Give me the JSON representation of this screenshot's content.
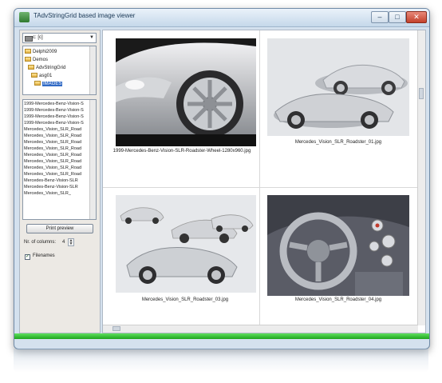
{
  "window": {
    "title": "TAdvStringGrid based image viewer",
    "minimize_glyph": "–",
    "maximize_glyph": "□",
    "close_glyph": "✕"
  },
  "sidebar": {
    "drive_label": "c: [c]",
    "drive_arrow": "▼",
    "tree": [
      {
        "label": "Delphi2009",
        "selected": false
      },
      {
        "label": "Demos",
        "selected": false
      },
      {
        "label": "AdvStringGrid",
        "selected": false
      },
      {
        "label": "asg01",
        "selected": false
      },
      {
        "label": "IMAGES",
        "selected": true
      }
    ],
    "files": [
      "1999-Mercedes-Benz-Vision-S",
      "1999-Mercedes-Benz-Vision-S",
      "1999-Mercedes-Benz-Vision-S",
      "1999-Mercedes-Benz-Vision-S",
      "Mercedes_Vision_SLR_Road",
      "Mercedes_Vision_SLR_Road",
      "Mercedes_Vision_SLR_Road",
      "Mercedes_Vision_SLR_Road",
      "Mercedes_Vision_SLR_Road",
      "Mercedes_Vision_SLR_Road",
      "Mercedes_Vision_SLR_Road",
      "Mercedes_Vision_SLR_Road",
      "Mercedes-Benz-Vision-SLR",
      "Mercedes-Benz-Vision-SLR",
      "Mercedes_Vision_SLR_"
    ],
    "print_preview_label": "Print preview",
    "columns_label": "Nr. of columns:",
    "columns_value": "4",
    "filenames_label": "Filenames",
    "filenames_checked": "✓"
  },
  "grid": {
    "cells": [
      {
        "caption": "1999-Mercedes-Benz-Vision-SLR-Roadster-Wheel-1280x960.jpg"
      },
      {
        "caption": "Mercedes_Vision_SLR_Roadster_01.jpg"
      },
      {
        "caption": "Mercedes_Vision_SLR_Roadster_03.jpg"
      },
      {
        "caption": "Mercedes_Vision_SLR_Roadster_04.jpg"
      }
    ]
  },
  "colors": {
    "window_bg": "#d4e1ee",
    "selection": "#316ac5",
    "status_green": "#1ea51e"
  }
}
